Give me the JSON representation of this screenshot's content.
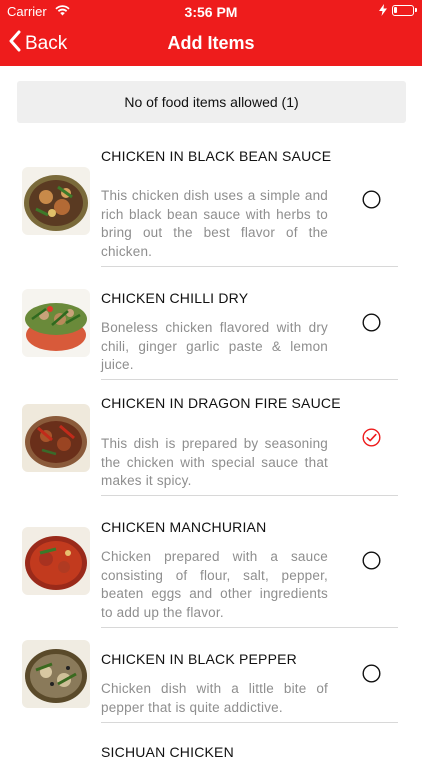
{
  "status": {
    "carrier": "Carrier",
    "time": "3:56 PM"
  },
  "nav": {
    "back_label": "Back",
    "title": "Add Items"
  },
  "banner": {
    "text": "No of food items allowed (1)"
  },
  "colors": {
    "accent": "#ee1c1c",
    "banner_bg": "#efefef",
    "desc": "#8e8e8e"
  },
  "items": [
    {
      "name": "CHICKEN IN BLACK BEAN SAUCE",
      "description": "This chicken dish uses a simple and rich black bean sauce with herbs to bring out the best flavor of the chicken.",
      "selected": false
    },
    {
      "name": "CHICKEN CHILLI DRY",
      "description": "Boneless chicken flavored with dry chili, ginger garlic paste & lemon juice.",
      "selected": false
    },
    {
      "name": "CHICKEN IN DRAGON FIRE SAUCE",
      "description": "This dish is prepared by seasoning the chicken with special sauce that makes it spicy.",
      "selected": true
    },
    {
      "name": "CHICKEN MANCHURIAN",
      "description": "Chicken prepared with a sauce consisting of flour, salt, pepper, beaten eggs and other ingredients to add up the flavor.",
      "selected": false
    },
    {
      "name": "CHICKEN IN BLACK PEPPER",
      "description": "Chicken dish with a little bite of pepper that is quite addictive.",
      "selected": false
    },
    {
      "name": "SICHUAN CHICKEN",
      "description": "",
      "selected": false
    }
  ]
}
